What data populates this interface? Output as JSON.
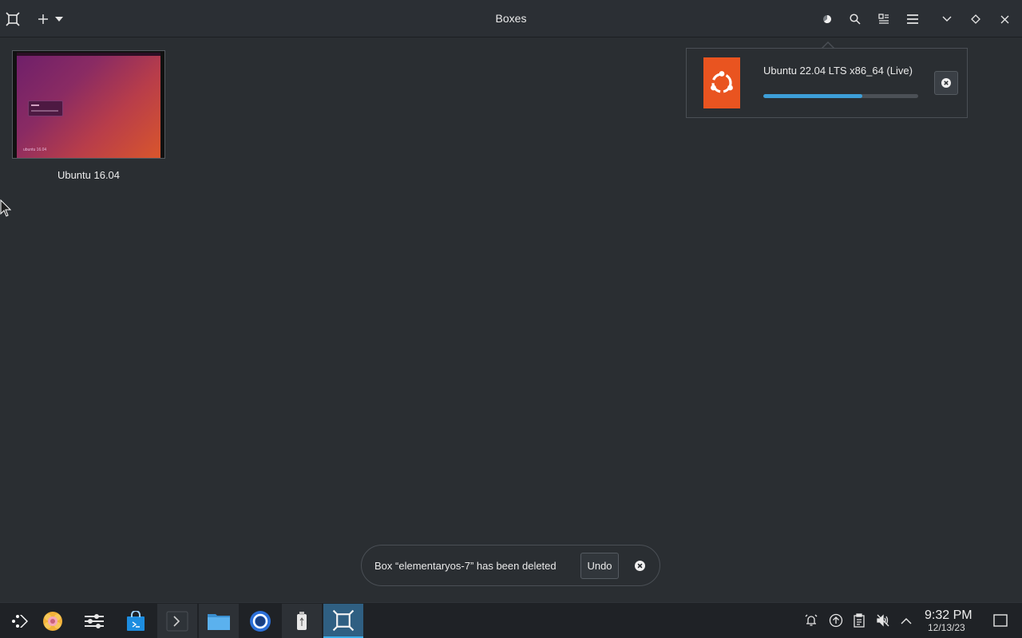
{
  "window": {
    "title": "Boxes"
  },
  "header": {
    "app_icon": "boxes-icon",
    "new_icon": "plus-icon",
    "new_menu_icon": "caret-down-icon",
    "downloads_icon": "download-progress-icon",
    "search_icon": "search-icon",
    "view_icon": "view-mode-icon",
    "menu_icon": "hamburger-menu-icon",
    "minimize_icon": "minimize-chevron-icon",
    "maximize_icon": "maximize-diamond-icon",
    "close_icon": "close-icon"
  },
  "boxes": [
    {
      "name": "Ubuntu 16.04",
      "thumbnail_brand": "ubuntu 16.04"
    }
  ],
  "download": {
    "title": "Ubuntu 22.04 LTS x86_64 (Live)",
    "progress": 0.64,
    "logo": "ubuntu-logo-icon",
    "logo_color": "#e95420",
    "cancel_icon": "cancel-circle-icon"
  },
  "toast": {
    "message": "Box “elementaryos-7” has been deleted",
    "undo_label": "Undo",
    "close_icon": "close-circle-icon"
  },
  "taskbar": {
    "items": [
      {
        "name": "application-launcher",
        "icon": "launcher-icon"
      },
      {
        "name": "app-avatar",
        "icon": "flower-avatar-icon"
      },
      {
        "name": "system-settings",
        "icon": "settings-sliders-icon"
      },
      {
        "name": "software-store",
        "icon": "store-bag-icon"
      },
      {
        "name": "terminal",
        "icon": "terminal-icon"
      },
      {
        "name": "file-manager",
        "icon": "folder-icon"
      },
      {
        "name": "web-browser",
        "icon": "browser-icon"
      },
      {
        "name": "usb-writer",
        "icon": "usb-icon"
      },
      {
        "name": "boxes",
        "icon": "boxes-icon"
      }
    ],
    "tray": {
      "notifications_icon": "alarm-bell-icon",
      "updates_icon": "update-arrow-icon",
      "clipboard_icon": "clipboard-icon",
      "volume_icon": "volume-muted-icon",
      "expand_icon": "chevron-up-icon",
      "show_desktop_icon": "show-desktop-icon"
    },
    "clock": {
      "time": "9:32 PM",
      "date": "12/13/23"
    }
  },
  "colors": {
    "accent": "#3daee9",
    "progress": "#3d9fd8",
    "background": "#2a2e32"
  }
}
